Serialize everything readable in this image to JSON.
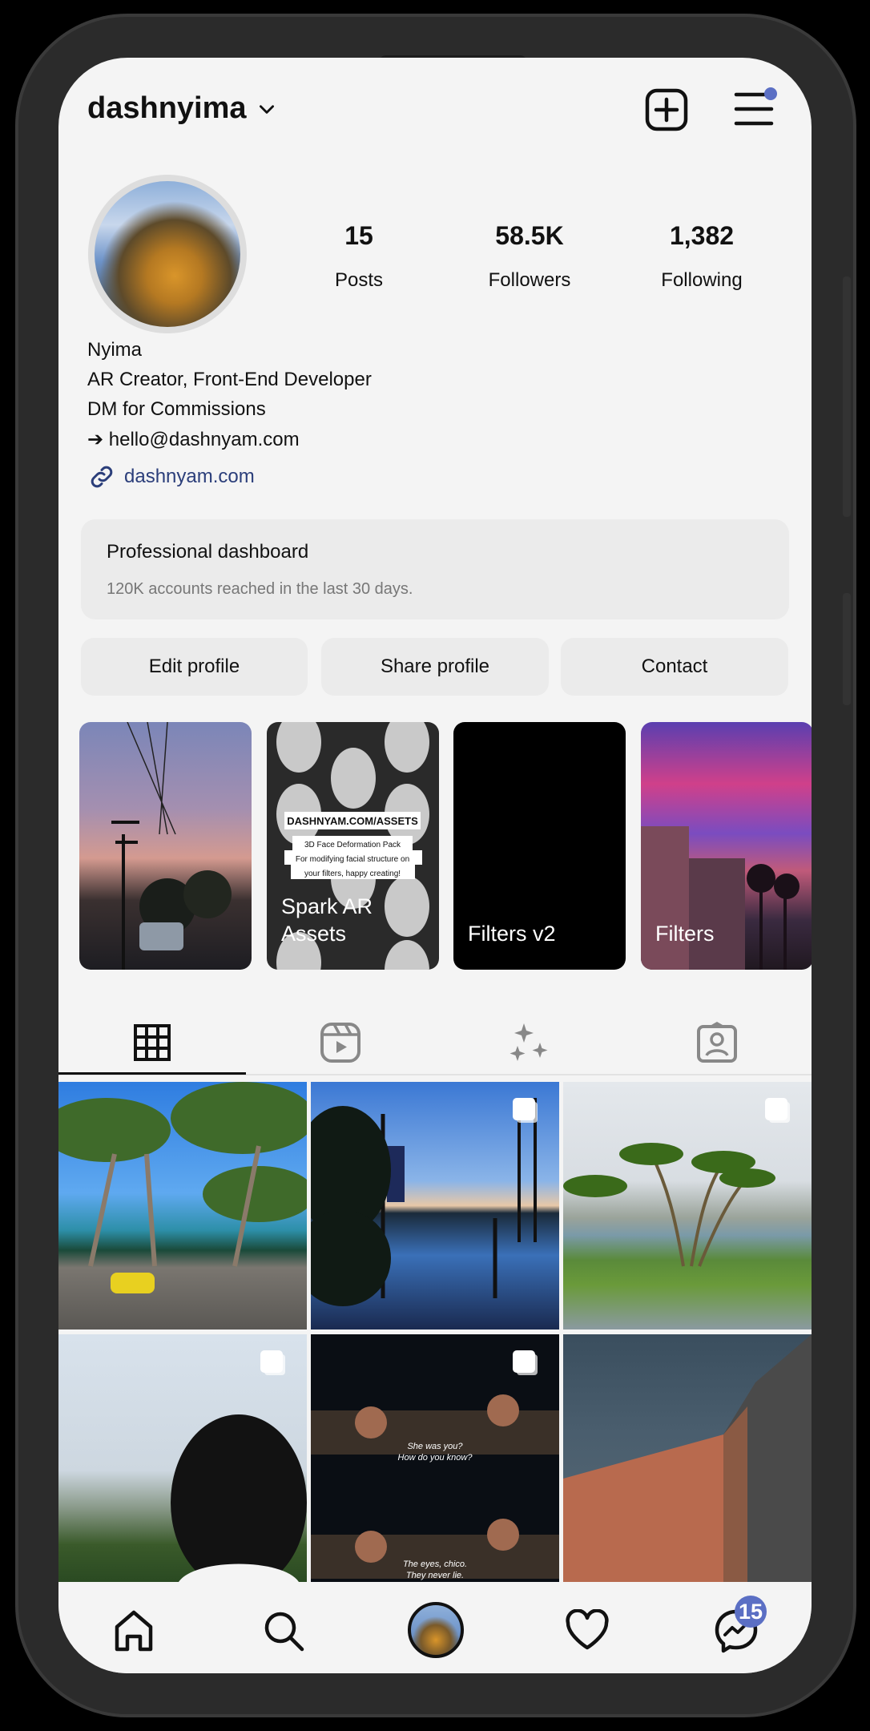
{
  "header": {
    "username": "dashnyima",
    "icons": [
      "chevron-down-icon",
      "new-post-icon",
      "menu-icon"
    ],
    "menu_badge_color": "#5b6fc4"
  },
  "profile": {
    "stats": [
      {
        "value": "15",
        "label": "Posts"
      },
      {
        "value": "58.5K",
        "label": "Followers"
      },
      {
        "value": "1,382",
        "label": "Following"
      }
    ],
    "name": "Nyima",
    "bio": [
      "AR Creator, Front-End Developer",
      "DM for Commissions",
      "➔ hello@dashnyam.com"
    ],
    "link": "dashnyam.com",
    "link_color": "#2b3e7a"
  },
  "dashboard": {
    "title": "Professional dashboard",
    "subtitle": "120K accounts reached in the last 30 days."
  },
  "buttons": {
    "edit": "Edit profile",
    "share": "Share profile",
    "contact": "Contact"
  },
  "highlights": [
    {
      "label": ""
    },
    {
      "label": "Spark AR Assets",
      "overlay": [
        "DASHNYAM.COM/ASSETS",
        "3D Face Deformation Pack",
        "For modifying facial structure on",
        "your filters, happy creating!"
      ]
    },
    {
      "label": "Filters v2"
    },
    {
      "label": "Filters"
    }
  ],
  "tabs": [
    "grid-icon",
    "reels-icon",
    "sparkles-icon",
    "tagged-icon"
  ],
  "grid": [
    {
      "multi": false
    },
    {
      "multi": true
    },
    {
      "multi": true
    },
    {
      "multi": true
    },
    {
      "multi": true,
      "captions": [
        "She was you?",
        "How do you know?",
        "The eyes, chico.",
        "They never lie."
      ]
    },
    {
      "multi": false
    }
  ],
  "nav": {
    "icons": [
      "home-icon",
      "search-icon",
      "profile-avatar",
      "heart-icon",
      "messenger-icon"
    ],
    "messages_badge": "15",
    "badge_color": "#5b6fc4"
  }
}
